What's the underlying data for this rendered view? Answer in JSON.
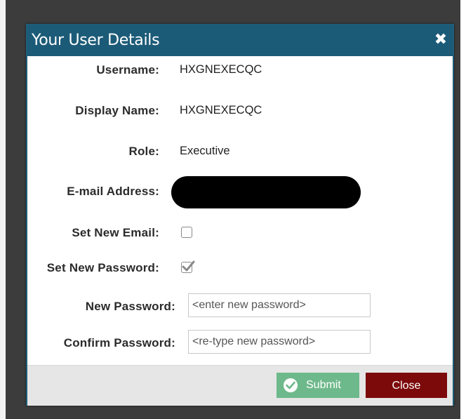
{
  "dialog": {
    "title": "Your User Details",
    "close_icon_glyph": "✖"
  },
  "fields": {
    "username": {
      "label": "Username:",
      "value": "HXGNEXECQC"
    },
    "display_name": {
      "label": "Display Name:",
      "value": "HXGNEXECQC"
    },
    "role": {
      "label": "Role:",
      "value": "Executive"
    },
    "email": {
      "label": "E-mail Address:",
      "value_redacted": true
    },
    "set_new_email": {
      "label": "Set New Email:",
      "checked": false
    },
    "set_new_password": {
      "label": "Set New Password:",
      "checked": true
    },
    "new_password": {
      "label": "New Password:",
      "placeholder": "<enter new password>"
    },
    "confirm_password": {
      "label": "Confirm Password:",
      "placeholder": "<re-type new password>"
    }
  },
  "footer": {
    "submit_label": "Submit",
    "close_label": "Close"
  },
  "colors": {
    "titlebar": "#1c5b78",
    "submit": "#6eb98b",
    "close": "#7c0a0a",
    "footer": "#e6e6e6"
  },
  "icons": {
    "close": "close-icon",
    "submit": "check-circle-icon",
    "checkbox_check": "checkmark-icon"
  }
}
